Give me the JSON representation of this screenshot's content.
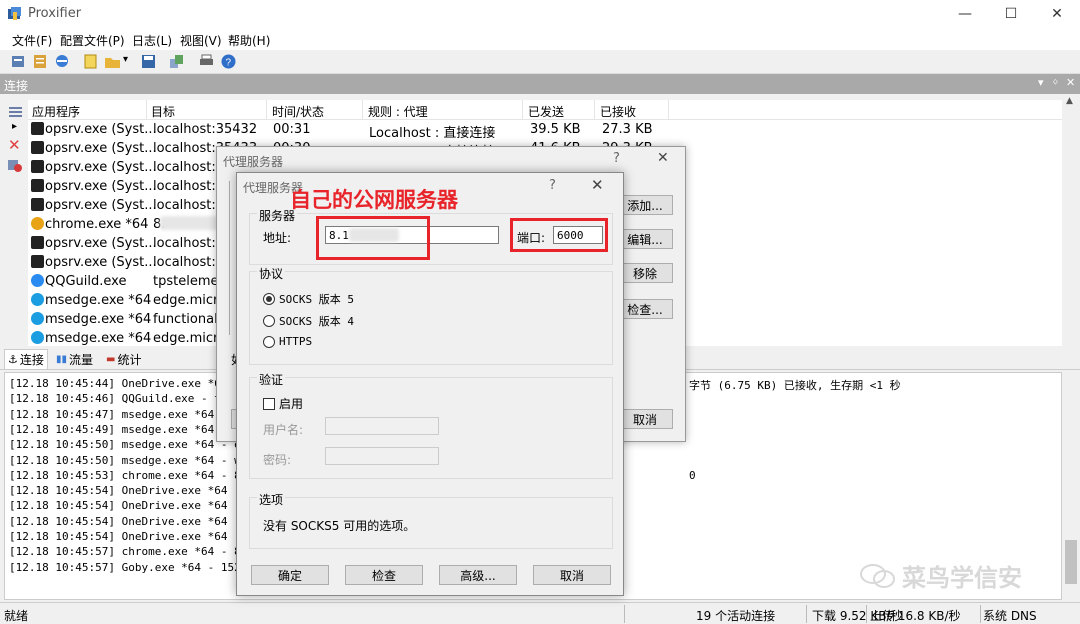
{
  "window": {
    "title": "Proxifier",
    "minimize": "—",
    "maximize": "☐",
    "close": "✕"
  },
  "menu": [
    "文件(F)",
    "配置文件(P)",
    "日志(L)",
    "视图(V)",
    "帮助(H)"
  ],
  "conn_panel": {
    "title": "连接",
    "pin": "▾",
    "pushpin": "ᛜ",
    "close": "✕"
  },
  "columns": [
    "应用程序",
    "目标",
    "时间/状态",
    "规则 : 代理",
    "已发送",
    "已接收"
  ],
  "rows": [
    {
      "app": "opsrv.exe (Syst...",
      "target": "localhost:35432",
      "time": "00:31",
      "rule": "Localhost : 直接连接",
      "sent": "39.5 KB",
      "recv": "27.3 KB",
      "icon": "opsrv-icon",
      "color": "#222"
    },
    {
      "app": "opsrv.exe (Syst...",
      "target": "localhost:35433",
      "time": "00:30",
      "rule": "Localhost : 直接连接",
      "sent": "41.6 KB",
      "recv": "29.3 KB",
      "icon": "opsrv-icon",
      "color": "#222"
    },
    {
      "app": "opsrv.exe (Syst...",
      "target": "localhost:35",
      "time": "",
      "rule": "",
      "sent": "",
      "recv": "",
      "icon": "opsrv-icon",
      "color": "#222"
    },
    {
      "app": "opsrv.exe (Syst...",
      "target": "localhost:35",
      "time": "",
      "rule": "",
      "sent": "",
      "recv": "",
      "icon": "opsrv-icon",
      "color": "#222"
    },
    {
      "app": "opsrv.exe (Syst...",
      "target": "localhost:35",
      "time": "",
      "rule": "",
      "sent": "",
      "recv": "",
      "icon": "opsrv-icon",
      "color": "#222"
    },
    {
      "app": "chrome.exe *64",
      "target": "8.",
      "time": "",
      "rule": "",
      "sent": "",
      "recv": "",
      "icon": "chrome-icon",
      "color": "#e8a317"
    },
    {
      "app": "opsrv.exe (Syst...",
      "target": "localhost:35",
      "time": "",
      "rule": "",
      "sent": "",
      "recv": "",
      "icon": "opsrv-icon",
      "color": "#222"
    },
    {
      "app": "opsrv.exe (Syst...",
      "target": "localhost:35",
      "time": "",
      "rule": "",
      "sent": "",
      "recv": "",
      "icon": "opsrv-icon",
      "color": "#222"
    },
    {
      "app": "QQGuild.exe",
      "target": "tpstelemet",
      "time": "",
      "rule": "",
      "sent": "",
      "recv": "",
      "icon": "qqguild-icon",
      "color": "#2a8cf0"
    },
    {
      "app": "msedge.exe *64",
      "target": "edge.micro",
      "time": "",
      "rule": "",
      "sent": "",
      "recv": "",
      "icon": "edge-icon",
      "color": "#1b9de2"
    },
    {
      "app": "msedge.exe *64",
      "target": "functional.e",
      "time": "",
      "rule": "",
      "sent": "",
      "recv": "",
      "icon": "edge-icon",
      "color": "#1b9de2"
    },
    {
      "app": "msedge.exe *64",
      "target": "edge.micro",
      "time": "",
      "rule": "",
      "sent": "",
      "recv": "",
      "icon": "edge-icon",
      "color": "#1b9de2"
    }
  ],
  "tabs": [
    "连接",
    "流量",
    "统计"
  ],
  "log": [
    {
      "text": "[12.18 10:45:44] OneDrive.exe *64",
      "tail": "字节 (6.75 KB) 已接收, 生存期 <1 秒"
    },
    {
      "text": "[12.18 10:45:46] QQGuild.exe - tp",
      "tail": ""
    },
    {
      "text": "[12.18 10:45:47] msedge.exe *64 -",
      "tail": ""
    },
    {
      "text": "[12.18 10:45:49] msedge.exe *64 -",
      "tail": ""
    },
    {
      "text": "[12.18 10:45:50] msedge.exe *64 - ed",
      "tail": ""
    },
    {
      "text": "[12.18 10:45:50] msedge.exe *64 - ww",
      "tail": ""
    },
    {
      "text": "[12.18 10:45:53] chrome.exe *64 - 8.",
      "tail": "0"
    },
    {
      "text": "[12.18 10:45:54] OneDrive.exe *64 -",
      "tail": ""
    },
    {
      "text": "[12.18 10:45:54] OneDrive.exe *64 -",
      "tail": ""
    },
    {
      "text": "[12.18 10:45:54] OneDrive.exe *64 -",
      "tail": ""
    },
    {
      "text": "[12.18 10:45:54] OneDrive.exe *64 -",
      "tail": ""
    },
    {
      "text": "[12.18 10:45:57] chrome.exe *64 - 8.",
      "tail": ""
    },
    {
      "text": "[12.18 10:45:57] Goby.exe *64 - 152.",
      "tail": ""
    }
  ],
  "status": {
    "ready": "就绪",
    "active": "19 个活动连接",
    "down": "下载 9.52 KB/秒",
    "up": "上传 16.8 KB/秒",
    "dns": "系统 DNS"
  },
  "watermark": "菜鸟学信安",
  "dialog_back": {
    "title": "代理服务器",
    "help": "?",
    "close": "✕",
    "buttons": [
      "添加...",
      "编辑...",
      "移除",
      "检查...",
      "取消"
    ],
    "fragment": "如"
  },
  "dialog": {
    "title": "代理服务器",
    "help": "?",
    "close": "✕",
    "annotation": "自己的公网服务器",
    "server_group": "服务器",
    "address_label": "地址:",
    "address_value": "8.1",
    "port_label": "端口:",
    "port_value": "6000",
    "protocol_group": "协议",
    "protocols": [
      {
        "label": "SOCKS 版本 5",
        "selected": true
      },
      {
        "label": "SOCKS 版本 4",
        "selected": false
      },
      {
        "label": "HTTPS",
        "selected": false
      }
    ],
    "auth_group": "验证",
    "auth_enable": "启用",
    "username_label": "用户名:",
    "password_label": "密码:",
    "options_group": "选项",
    "options_text": "没有 SOCKS5 可用的选项。",
    "buttons": [
      "确定",
      "检查",
      "高级...",
      "取消"
    ]
  },
  "accent_red": "#e8242a"
}
